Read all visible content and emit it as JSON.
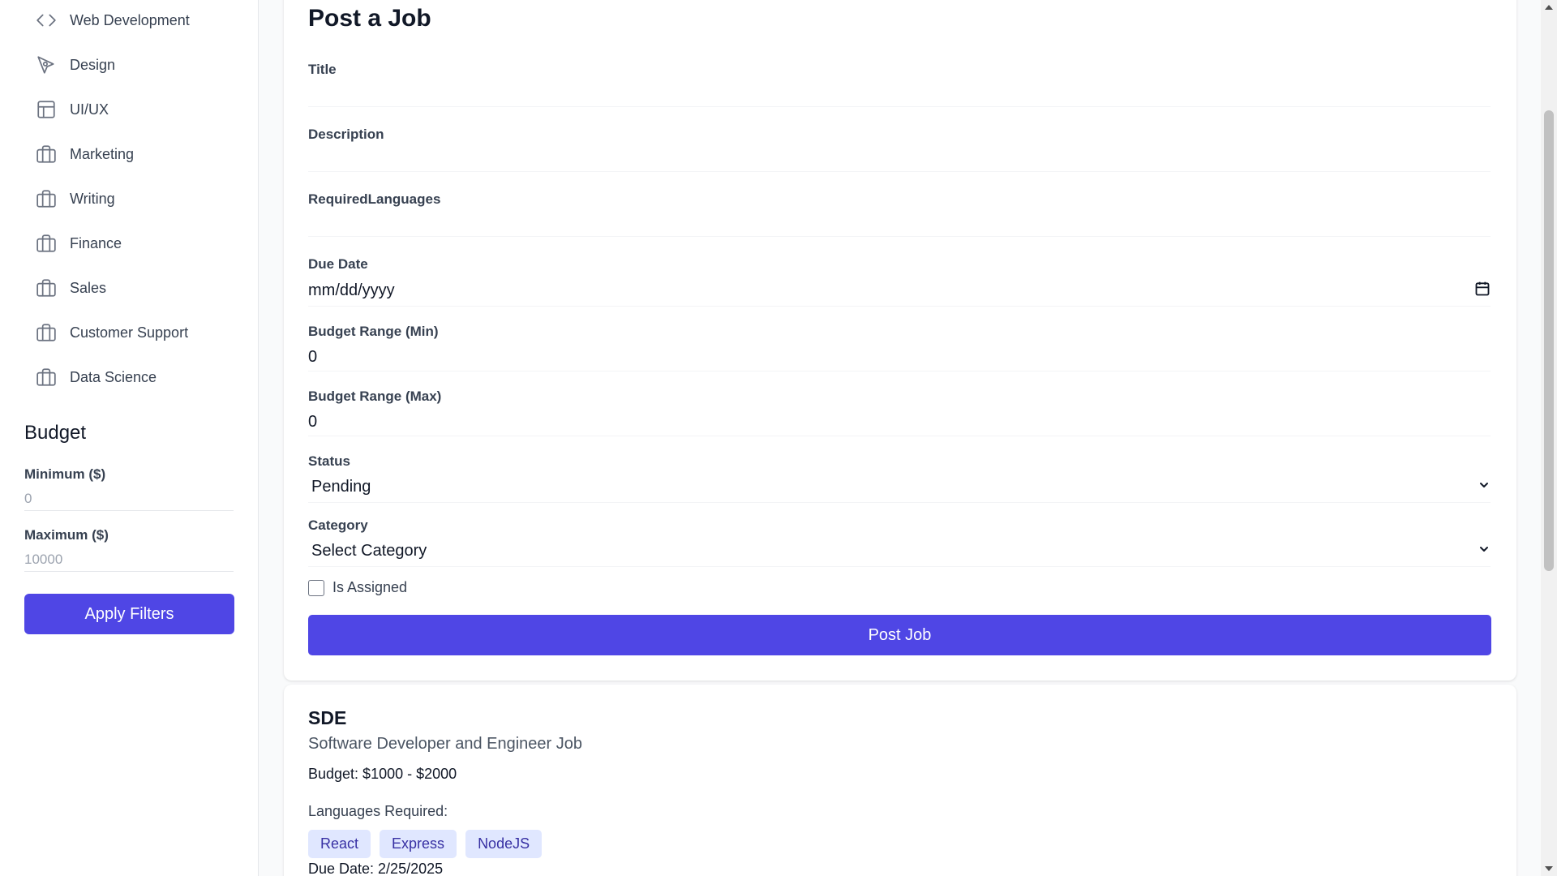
{
  "sidebar": {
    "categories": [
      {
        "label": "Web Development",
        "icon": "code-icon"
      },
      {
        "label": "Design",
        "icon": "pen-tool-icon"
      },
      {
        "label": "UI/UX",
        "icon": "layout-icon"
      },
      {
        "label": "Marketing",
        "icon": "briefcase-icon"
      },
      {
        "label": "Writing",
        "icon": "briefcase-icon"
      },
      {
        "label": "Finance",
        "icon": "briefcase-icon"
      },
      {
        "label": "Sales",
        "icon": "briefcase-icon"
      },
      {
        "label": "Customer Support",
        "icon": "briefcase-icon"
      },
      {
        "label": "Data Science",
        "icon": "briefcase-icon"
      }
    ],
    "budget": {
      "title": "Budget",
      "min_label": "Minimum ($)",
      "min_placeholder": "0",
      "max_label": "Maximum ($)",
      "max_placeholder": "10000",
      "apply_label": "Apply Filters"
    }
  },
  "post_form": {
    "title": "Post a Job",
    "fields": {
      "title_label": "Title",
      "title_value": "",
      "description_label": "Description",
      "description_value": "",
      "languages_label": "RequiredLanguages",
      "languages_value": "",
      "due_date_label": "Due Date",
      "due_date_placeholder": "mm/dd/yyyy",
      "budget_min_label": "Budget Range (Min)",
      "budget_min_value": "0",
      "budget_max_label": "Budget Range (Max)",
      "budget_max_value": "0",
      "status_label": "Status",
      "status_value": "Pending",
      "category_label": "Category",
      "category_value": "Select Category",
      "assigned_label": "Is Assigned"
    },
    "submit_label": "Post Job"
  },
  "job": {
    "title": "SDE",
    "description": "Software Developer and Engineer Job",
    "budget": "Budget: $1000 - $2000",
    "languages_label": "Languages Required:",
    "languages": [
      "React",
      "Express",
      "NodeJS"
    ],
    "due_date": "Due Date: 2/25/2025"
  },
  "colors": {
    "primary": "#4f46e5",
    "tag_bg": "#e0e7ff",
    "tag_text": "#3730a3"
  }
}
